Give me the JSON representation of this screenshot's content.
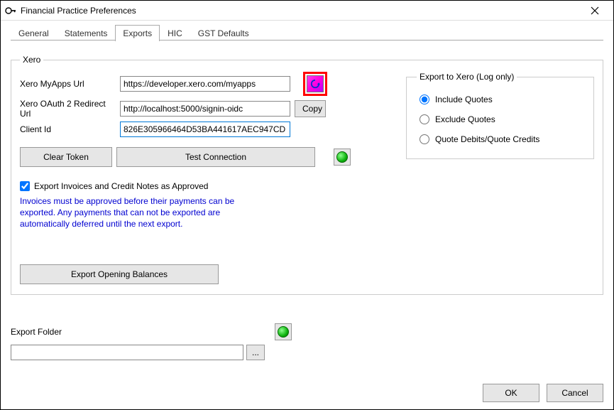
{
  "window": {
    "title": "Financial Practice Preferences"
  },
  "tabs": {
    "general": "General",
    "statements": "Statements",
    "exports": "Exports",
    "hic": "HIC",
    "gst": "GST Defaults"
  },
  "xero": {
    "legend": "Xero",
    "myapps_label": "Xero MyApps Url",
    "myapps_value": "https://developer.xero.com/myapps",
    "redirect_label": "Xero OAuth 2 Redirect Url",
    "redirect_value": "http://localhost:5000/signin-oidc",
    "clientid_label": "Client Id",
    "clientid_value": "826E305966464D53BA441617AEC947CD",
    "copy_label": "Copy",
    "clear_token_label": "Clear Token",
    "test_connection_label": "Test Connection",
    "approved_checkbox": "Export Invoices and Credit Notes as Approved",
    "approved_note": "Invoices must be approved before their payments can be exported. Any payments that can not be exported are automatically deferred until the next export.",
    "export_balances_label": "Export Opening Balances"
  },
  "export_to": {
    "legend": "Export to Xero (Log only)",
    "include": "Include Quotes",
    "exclude": "Exclude Quotes",
    "debits": "Quote Debits/Quote Credits"
  },
  "export_folder": {
    "label": "Export Folder",
    "value": "",
    "browse": "..."
  },
  "footer": {
    "ok": "OK",
    "cancel": "Cancel"
  }
}
